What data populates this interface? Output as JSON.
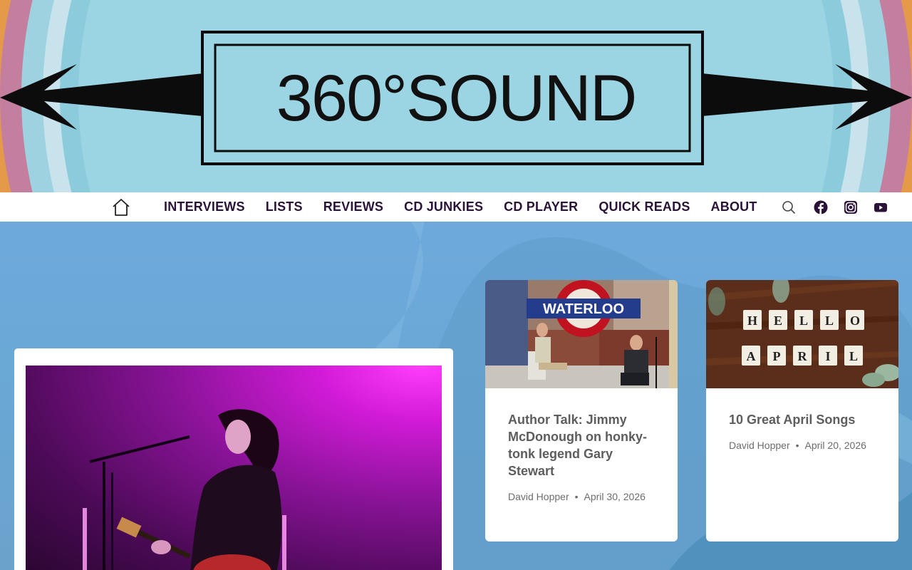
{
  "site": {
    "logo_text": "360°SOUND"
  },
  "nav": {
    "home_icon": "home-icon",
    "items": [
      {
        "label": "INTERVIEWS"
      },
      {
        "label": "LISTS"
      },
      {
        "label": "REVIEWS"
      },
      {
        "label": "CD JUNKIES"
      },
      {
        "label": "CD PLAYER"
      },
      {
        "label": "QUICK READS"
      },
      {
        "label": "ABOUT"
      }
    ],
    "icons": [
      "search-icon",
      "facebook-icon",
      "instagram-icon",
      "youtube-icon"
    ]
  },
  "posts": [
    {
      "title": "Author Talk: Jimmy McDonough on honky-tonk legend Gary Stewart",
      "author": "David Hopper",
      "date": "April 30, 2026",
      "image_sign": "WATERLOO"
    },
    {
      "title": "10 Great April Songs",
      "author": "David Hopper",
      "date": "April 20, 2026",
      "image_tiles_top": [
        "H",
        "E",
        "L",
        "L",
        "O"
      ],
      "image_tiles_bottom": [
        "A",
        "P",
        "R",
        "I",
        "L"
      ]
    }
  ],
  "colors": {
    "nav_text": "#2b1238",
    "banner_bg": "#98d3e0",
    "banner_orange": "#e59a4a",
    "banner_pink": "#c47f9e"
  }
}
